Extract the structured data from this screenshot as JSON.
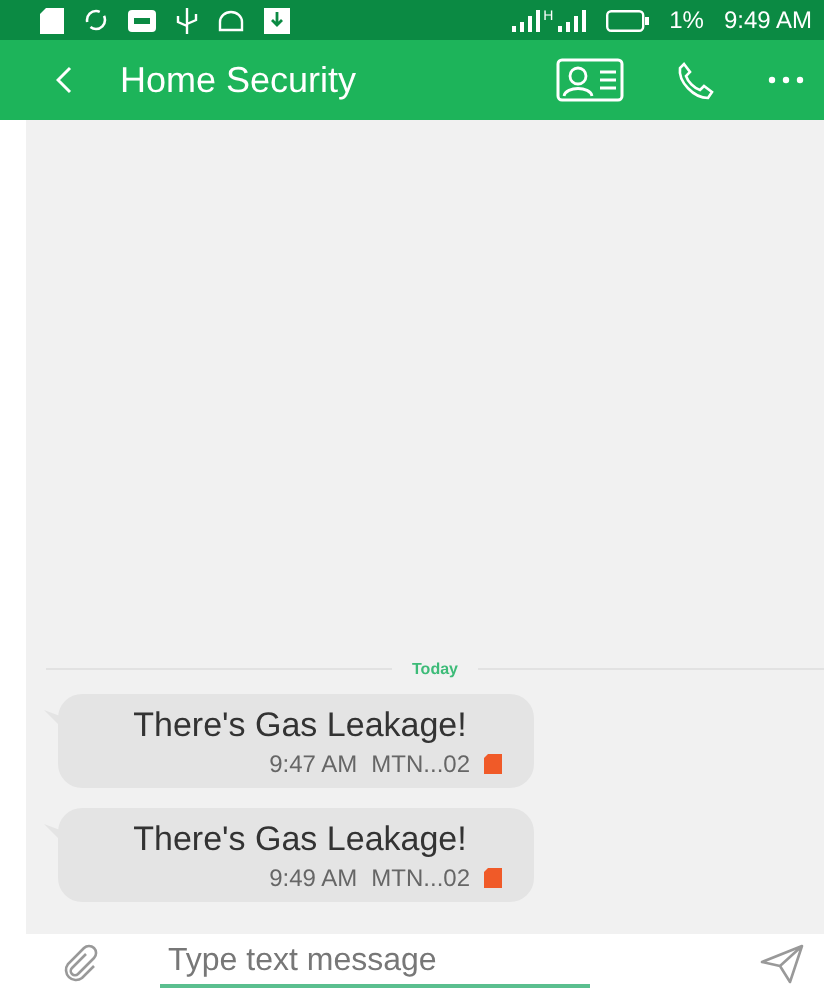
{
  "status_bar": {
    "network": "H",
    "battery": "1%",
    "time": "9:49 AM"
  },
  "header": {
    "title": "Home Security"
  },
  "date_divider": "Today",
  "messages": [
    {
      "text": "There's Gas Leakage!",
      "time": "9:47 AM",
      "sim": "MTN...02"
    },
    {
      "text": "There's Gas Leakage!",
      "time": "9:49 AM",
      "sim": "MTN...02"
    }
  ],
  "composer": {
    "placeholder": "Type text message"
  }
}
